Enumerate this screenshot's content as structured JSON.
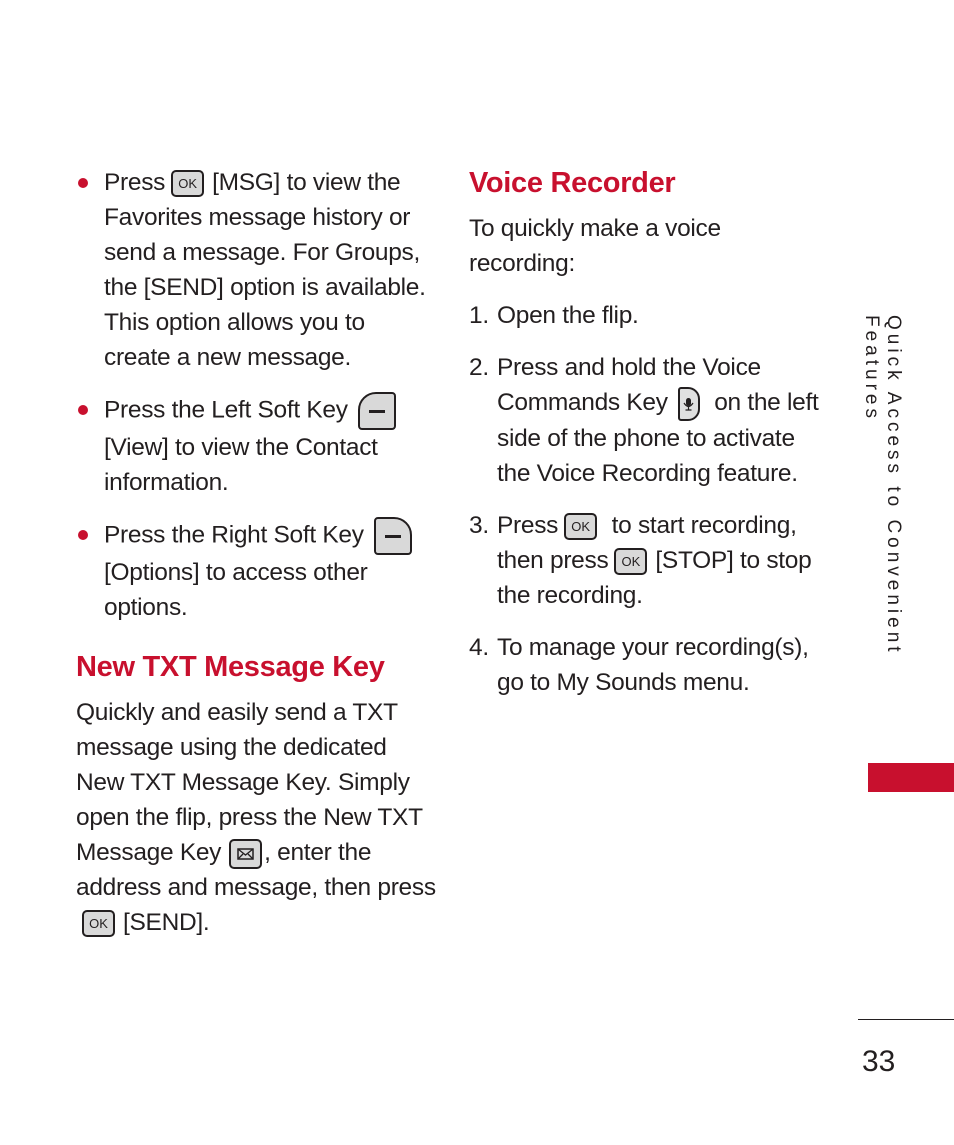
{
  "colors": {
    "accent": "#c8102e",
    "text": "#231f20",
    "key_fill": "#d9d9d9"
  },
  "icons": {
    "ok_key": {
      "name": "ok-key-icon",
      "label": "OK"
    },
    "left_soft_key": {
      "name": "left-soft-key-icon"
    },
    "right_soft_key": {
      "name": "right-soft-key-icon"
    },
    "new_txt_key": {
      "name": "envelope-key-icon",
      "glyph": "✉"
    },
    "voice_key": {
      "name": "microphone-key-icon",
      "glyph": "🎙"
    },
    "bullet": {
      "name": "bullet-dot"
    }
  },
  "left_column": {
    "bullets": [
      {
        "pre": "Press",
        "key_label": "[MSG]",
        "post": " to view the Favorites message history or send a message. For Groups, the ",
        "key2_label": "[SEND]",
        "post2": " option is available. This option allows you to create a new message."
      },
      {
        "pre": "Press the Left Soft Key",
        "key_label": "[View]",
        "post": " to view the Contact information."
      },
      {
        "pre": "Press the Right Soft Key",
        "key_label": "[Options]",
        "post": " to access other options."
      }
    ],
    "section_heading": "New TXT Message Key",
    "section_body_pre": "Quickly and easily send a TXT message using the dedicated New TXT Message Key. Simply open the flip, press the New TXT Message Key",
    "section_body_mid": ", enter the address and message, then press",
    "section_body_key": "[SEND]",
    "section_body_end": "."
  },
  "right_column": {
    "section_heading": "Voice Recorder",
    "intro": "To quickly make a voice recording:",
    "steps": [
      {
        "num": "1.",
        "text": "Open the flip."
      },
      {
        "num": "2.",
        "pre": "Press and hold the Voice Commands Key",
        "post": " on the left side of the phone to activate the Voice Recording feature."
      },
      {
        "num": "3.",
        "pre": "Press",
        "mid": " to start recording, then press",
        "key_label": "[STOP]",
        "post": " to stop the recording."
      },
      {
        "num": "4.",
        "text": "To manage your recording(s), go to My Sounds menu."
      }
    ]
  },
  "side_tab": {
    "text": "Quick Access to Convenient Features"
  },
  "page_number": "33"
}
